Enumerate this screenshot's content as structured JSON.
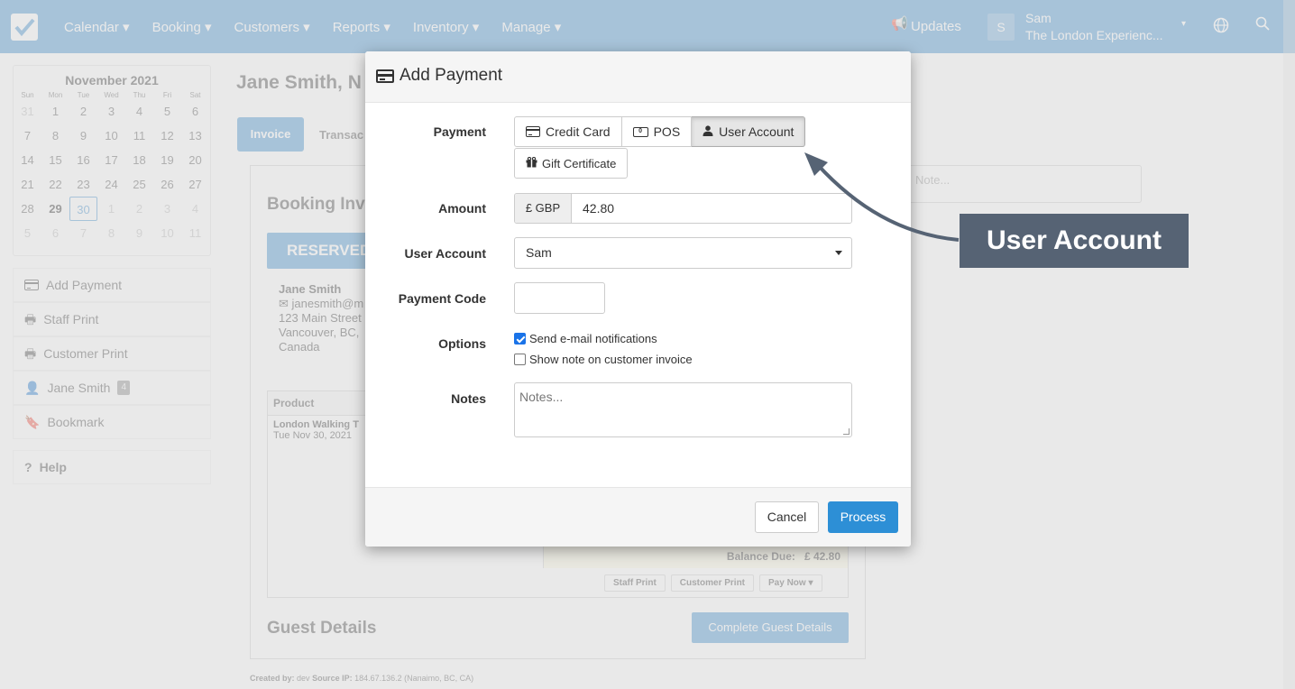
{
  "nav": {
    "items": [
      "Calendar ▾",
      "Booking ▾",
      "Customers ▾",
      "Reports ▾",
      "Inventory ▾",
      "Manage ▾"
    ],
    "updates_label": "Updates",
    "avatar_letter": "S",
    "user_name": "Sam",
    "user_company": "The London Experienc..."
  },
  "calendar": {
    "title": "November 2021",
    "dow": [
      "Sun",
      "Mon",
      "Tue",
      "Wed",
      "Thu",
      "Fri",
      "Sat"
    ],
    "days": [
      "31",
      "1",
      "2",
      "3",
      "4",
      "5",
      "6",
      "7",
      "8",
      "9",
      "10",
      "11",
      "12",
      "13",
      "14",
      "15",
      "16",
      "17",
      "18",
      "19",
      "20",
      "21",
      "22",
      "23",
      "24",
      "25",
      "26",
      "27",
      "28",
      "29",
      "30",
      "1",
      "2",
      "3",
      "4",
      "5",
      "6",
      "7",
      "8",
      "9",
      "10",
      "11"
    ]
  },
  "sidebar": {
    "add_payment": "Add Payment",
    "staff_print": "Staff Print",
    "customer_print": "Customer Print",
    "customer_name": "Jane Smith",
    "customer_badge": "4",
    "bookmark": "Bookmark",
    "help": "Help"
  },
  "page": {
    "title": "Jane Smith, N",
    "tab_invoice": "Invoice",
    "tab_transactions": "Transac",
    "booking_invoice": "Booking Inv",
    "status": "RESERVED",
    "customer": {
      "name": "Jane Smith",
      "email": "janesmith@m",
      "street": "123 Main Street",
      "city": "Vancouver, BC,",
      "country": "Canada"
    },
    "product_header": "Product",
    "product_name": "London Walking T",
    "product_date": "Tue Nov 30, 2021",
    "balance_label": "Balance Due:",
    "balance_value": "£ 42.80",
    "btn_staff_print": "Staff Print",
    "btn_customer_print": "Customer Print",
    "btn_pay_now": "Pay Now ▾",
    "guest_details": "Guest Details",
    "complete_guest": "Complete Guest Details",
    "created_by_label": "Created by:",
    "created_by": "dev",
    "source_ip_label": "Source IP:",
    "source_ip": "184.67.136.2 (Nanaimo, BC, CA)",
    "note_placeholder": "Note..."
  },
  "modal": {
    "title": "Add Payment",
    "payment_label": "Payment",
    "payment_methods": {
      "credit_card": "Credit Card",
      "pos": "POS",
      "user_account": "User Account",
      "gift_certificate": "Gift Certificate"
    },
    "selected_method": "User Account",
    "amount_label": "Amount",
    "currency": "£ GBP",
    "amount_value": "42.80",
    "user_account_label": "User Account",
    "user_account_value": "Sam",
    "payment_code_label": "Payment Code",
    "payment_code_value": "",
    "options_label": "Options",
    "option_email": "Send e-mail notifications",
    "option_email_checked": true,
    "option_show_note": "Show note on customer invoice",
    "option_show_note_checked": false,
    "notes_label": "Notes",
    "notes_placeholder": "Notes...",
    "cancel": "Cancel",
    "process": "Process"
  },
  "callout": {
    "text": "User Account"
  },
  "colors": {
    "primary": "#3d8fd0",
    "process_button": "#2d8fd6",
    "callout_bg": "#566374"
  }
}
